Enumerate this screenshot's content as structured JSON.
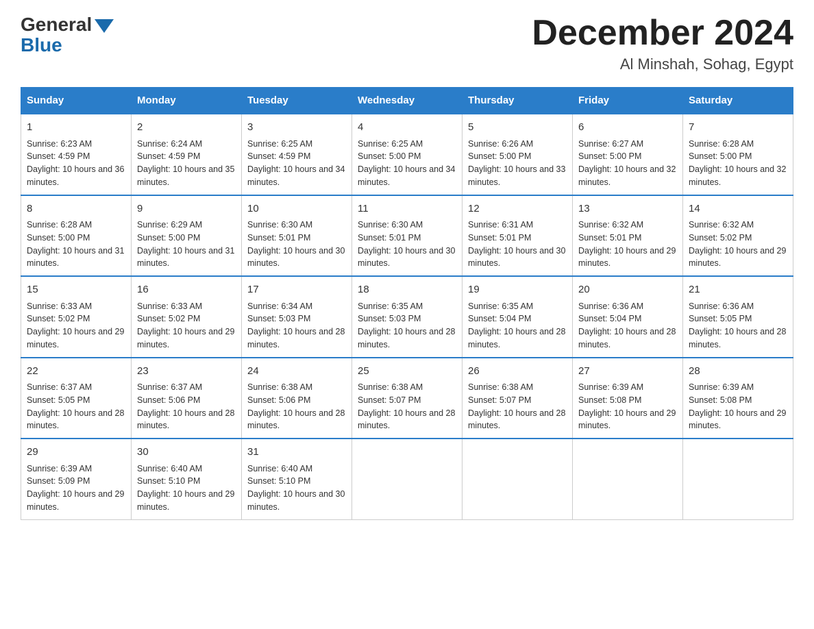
{
  "logo": {
    "general": "General",
    "blue": "Blue"
  },
  "title": {
    "month_year": "December 2024",
    "location": "Al Minshah, Sohag, Egypt"
  },
  "days_of_week": [
    "Sunday",
    "Monday",
    "Tuesday",
    "Wednesday",
    "Thursday",
    "Friday",
    "Saturday"
  ],
  "weeks": [
    [
      {
        "day": "1",
        "sunrise": "6:23 AM",
        "sunset": "4:59 PM",
        "daylight": "10 hours and 36 minutes."
      },
      {
        "day": "2",
        "sunrise": "6:24 AM",
        "sunset": "4:59 PM",
        "daylight": "10 hours and 35 minutes."
      },
      {
        "day": "3",
        "sunrise": "6:25 AM",
        "sunset": "4:59 PM",
        "daylight": "10 hours and 34 minutes."
      },
      {
        "day": "4",
        "sunrise": "6:25 AM",
        "sunset": "5:00 PM",
        "daylight": "10 hours and 34 minutes."
      },
      {
        "day": "5",
        "sunrise": "6:26 AM",
        "sunset": "5:00 PM",
        "daylight": "10 hours and 33 minutes."
      },
      {
        "day": "6",
        "sunrise": "6:27 AM",
        "sunset": "5:00 PM",
        "daylight": "10 hours and 32 minutes."
      },
      {
        "day": "7",
        "sunrise": "6:28 AM",
        "sunset": "5:00 PM",
        "daylight": "10 hours and 32 minutes."
      }
    ],
    [
      {
        "day": "8",
        "sunrise": "6:28 AM",
        "sunset": "5:00 PM",
        "daylight": "10 hours and 31 minutes."
      },
      {
        "day": "9",
        "sunrise": "6:29 AM",
        "sunset": "5:00 PM",
        "daylight": "10 hours and 31 minutes."
      },
      {
        "day": "10",
        "sunrise": "6:30 AM",
        "sunset": "5:01 PM",
        "daylight": "10 hours and 30 minutes."
      },
      {
        "day": "11",
        "sunrise": "6:30 AM",
        "sunset": "5:01 PM",
        "daylight": "10 hours and 30 minutes."
      },
      {
        "day": "12",
        "sunrise": "6:31 AM",
        "sunset": "5:01 PM",
        "daylight": "10 hours and 30 minutes."
      },
      {
        "day": "13",
        "sunrise": "6:32 AM",
        "sunset": "5:01 PM",
        "daylight": "10 hours and 29 minutes."
      },
      {
        "day": "14",
        "sunrise": "6:32 AM",
        "sunset": "5:02 PM",
        "daylight": "10 hours and 29 minutes."
      }
    ],
    [
      {
        "day": "15",
        "sunrise": "6:33 AM",
        "sunset": "5:02 PM",
        "daylight": "10 hours and 29 minutes."
      },
      {
        "day": "16",
        "sunrise": "6:33 AM",
        "sunset": "5:02 PM",
        "daylight": "10 hours and 29 minutes."
      },
      {
        "day": "17",
        "sunrise": "6:34 AM",
        "sunset": "5:03 PM",
        "daylight": "10 hours and 28 minutes."
      },
      {
        "day": "18",
        "sunrise": "6:35 AM",
        "sunset": "5:03 PM",
        "daylight": "10 hours and 28 minutes."
      },
      {
        "day": "19",
        "sunrise": "6:35 AM",
        "sunset": "5:04 PM",
        "daylight": "10 hours and 28 minutes."
      },
      {
        "day": "20",
        "sunrise": "6:36 AM",
        "sunset": "5:04 PM",
        "daylight": "10 hours and 28 minutes."
      },
      {
        "day": "21",
        "sunrise": "6:36 AM",
        "sunset": "5:05 PM",
        "daylight": "10 hours and 28 minutes."
      }
    ],
    [
      {
        "day": "22",
        "sunrise": "6:37 AM",
        "sunset": "5:05 PM",
        "daylight": "10 hours and 28 minutes."
      },
      {
        "day": "23",
        "sunrise": "6:37 AM",
        "sunset": "5:06 PM",
        "daylight": "10 hours and 28 minutes."
      },
      {
        "day": "24",
        "sunrise": "6:38 AM",
        "sunset": "5:06 PM",
        "daylight": "10 hours and 28 minutes."
      },
      {
        "day": "25",
        "sunrise": "6:38 AM",
        "sunset": "5:07 PM",
        "daylight": "10 hours and 28 minutes."
      },
      {
        "day": "26",
        "sunrise": "6:38 AM",
        "sunset": "5:07 PM",
        "daylight": "10 hours and 28 minutes."
      },
      {
        "day": "27",
        "sunrise": "6:39 AM",
        "sunset": "5:08 PM",
        "daylight": "10 hours and 29 minutes."
      },
      {
        "day": "28",
        "sunrise": "6:39 AM",
        "sunset": "5:08 PM",
        "daylight": "10 hours and 29 minutes."
      }
    ],
    [
      {
        "day": "29",
        "sunrise": "6:39 AM",
        "sunset": "5:09 PM",
        "daylight": "10 hours and 29 minutes."
      },
      {
        "day": "30",
        "sunrise": "6:40 AM",
        "sunset": "5:10 PM",
        "daylight": "10 hours and 29 minutes."
      },
      {
        "day": "31",
        "sunrise": "6:40 AM",
        "sunset": "5:10 PM",
        "daylight": "10 hours and 30 minutes."
      },
      null,
      null,
      null,
      null
    ]
  ],
  "labels": {
    "sunrise": "Sunrise:",
    "sunset": "Sunset:",
    "daylight": "Daylight:"
  }
}
